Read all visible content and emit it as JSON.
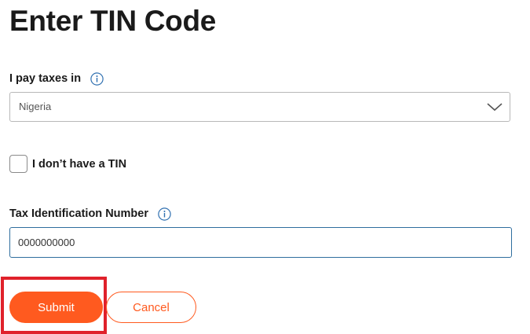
{
  "page": {
    "title": "Enter TIN Code"
  },
  "tax_country": {
    "label": "I pay taxes in",
    "info_icon": "info-icon",
    "selected_value": "Nigeria",
    "dropdown_icon": "chevron-down-icon"
  },
  "no_tin": {
    "label": "I don’t have a TIN",
    "checked": false
  },
  "tin": {
    "label": "Tax Identification Number",
    "info_icon": "info-icon",
    "value": "0000000000"
  },
  "actions": {
    "submit_label": "Submit",
    "cancel_label": "Cancel"
  },
  "colors": {
    "accent": "#ff5a1f",
    "info_blue": "#2e6fb0",
    "highlight_red": "#e0212b",
    "input_focus_border": "#2f6e9e"
  }
}
